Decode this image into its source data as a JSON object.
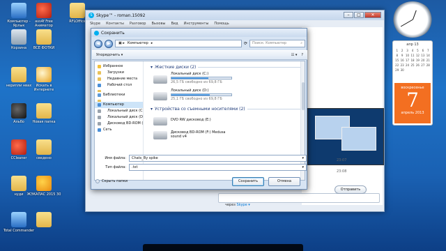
{
  "desktop_icons": [
    {
      "label": "Компьютер - Ярлык",
      "kind": "blue"
    },
    {
      "label": "avs4f Free Аниматор",
      "kind": "red"
    },
    {
      "label": "RFLOffice",
      "kind": "folder"
    },
    {
      "label": "Корзина",
      "kind": "bin"
    },
    {
      "label": "ВСЕ ФОТКИ",
      "kind": "folder"
    },
    {
      "label": "нерипли нвах",
      "kind": "folder"
    },
    {
      "label": "Искать в Интернете",
      "kind": "magn"
    },
    {
      "label": "Альбо",
      "kind": "black"
    },
    {
      "label": "Новая папка",
      "kind": "folder"
    },
    {
      "label": "CCleaner",
      "kind": "red"
    },
    {
      "label": "сведено",
      "kind": "folder"
    },
    {
      "label": "нуди",
      "kind": "folder"
    },
    {
      "label": "ЖЭКАПАС 2015 30",
      "kind": "orange"
    },
    {
      "label": "Total Commander",
      "kind": "blue"
    },
    {
      "label": "",
      "kind": "folder"
    }
  ],
  "calendar": {
    "month_header": "апр 13",
    "days": [
      "1",
      "2",
      "3",
      "4",
      "5",
      "6",
      "7",
      "8",
      "9",
      "10",
      "11",
      "12",
      "13",
      "14",
      "15",
      "16",
      "17",
      "18",
      "19",
      "20",
      "21",
      "22",
      "23",
      "24",
      "25",
      "26",
      "27",
      "28",
      "29",
      "30"
    ],
    "weekday": "воскресенье",
    "big_day": "7",
    "month_year": "апрель 2013"
  },
  "skype": {
    "title": "Skype™ - roman.15092",
    "menu": [
      "Skype",
      "Контакты",
      "Разговор",
      "Вызовы",
      "Вид",
      "Инструменты",
      "Помощь"
    ],
    "times": [
      "23:07",
      "23:08"
    ],
    "send_label": "Отправить",
    "via_prefix": "через",
    "via_value": "Skype ▾"
  },
  "dialog": {
    "title": "Сохранить",
    "address": {
      "computer": "Компьютер",
      "search_placeholder": "Поиск: Компьютер"
    },
    "toolbar": {
      "organize": "Упорядочить ▾"
    },
    "tree": [
      {
        "label": "Избранное",
        "selected": false
      },
      {
        "label": "Загрузки",
        "selected": false
      },
      {
        "label": "Недавние места",
        "selected": false
      },
      {
        "label": "Рабочий стол",
        "selected": false
      },
      {
        "label": "",
        "selected": false
      },
      {
        "label": "Библиотеки",
        "selected": false
      },
      {
        "label": "",
        "selected": false
      },
      {
        "label": "Компьютер",
        "selected": true
      },
      {
        "label": "Локальный диск (C:)",
        "selected": false
      },
      {
        "label": "Локальный диск (D:)",
        "selected": false
      },
      {
        "label": "Дисковод BD-ROM (F:)",
        "selected": false
      },
      {
        "label": "Сеть",
        "selected": false
      }
    ],
    "sections": {
      "hdd": "Жесткие диски (2)",
      "removable": "Устройства со съемными носителями (2)"
    },
    "drives": [
      {
        "name": "Локальный диск (C:)",
        "free": "26,5 ГБ свободно из 69,8 ГБ",
        "used_fraction": 0.62
      },
      {
        "name": "Локальный диск (D:)",
        "free": "25,1 ГБ свободно из 69,8 ГБ",
        "used_fraction": 0.64
      }
    ],
    "removable": [
      {
        "name": "DVD RW дисковод (E:)",
        "free": ""
      },
      {
        "name": "Дисковод BD-ROM (F:) Medusa",
        "free": "sound v4"
      }
    ],
    "filename_label": "Имя файла:",
    "filename_value": "Chats_By spike",
    "type_label": "Тип файла:",
    "type_value": ".txt",
    "hide_folders": "Скрыть папки",
    "save": "Сохранить",
    "cancel": "Отмена"
  }
}
